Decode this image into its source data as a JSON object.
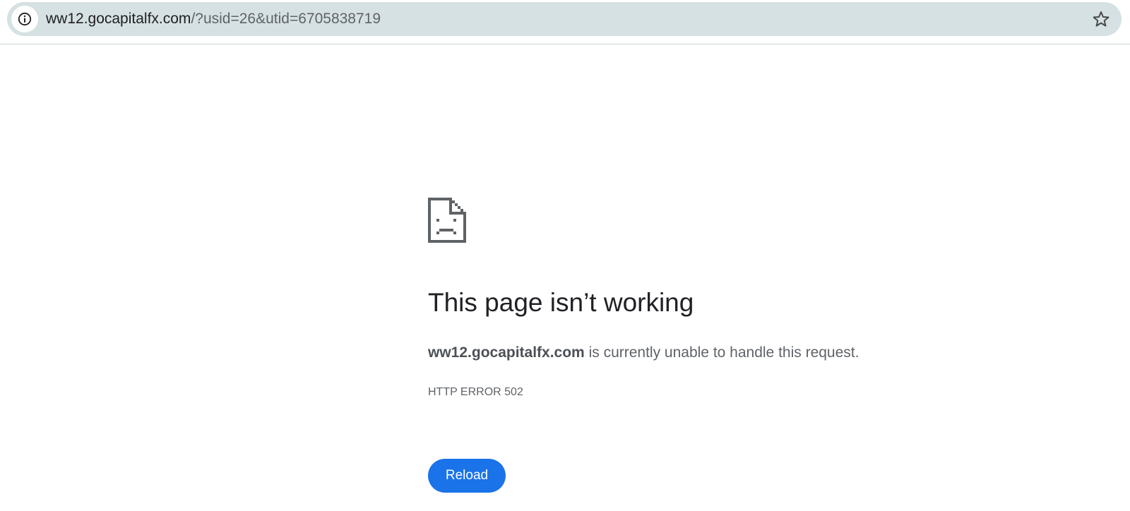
{
  "address_bar": {
    "host": "ww12.gocapitalfx.com",
    "path": "/?usid=26&utid=6705838719",
    "site_info_icon": "info-circle-icon",
    "bookmark_icon": "star-outline-icon"
  },
  "error_page": {
    "icon": "sad-page-icon",
    "title": "This page isn’t working",
    "summary_host": "ww12.gocapitalfx.com",
    "summary_text": " is currently unable to handle this request.",
    "error_code": "HTTP ERROR 502",
    "reload_label": "Reload"
  },
  "colors": {
    "accent": "#1a73e8",
    "omnibox_bg": "#d6e1e3",
    "title_text": "#202124",
    "secondary_text": "#5f6368"
  }
}
